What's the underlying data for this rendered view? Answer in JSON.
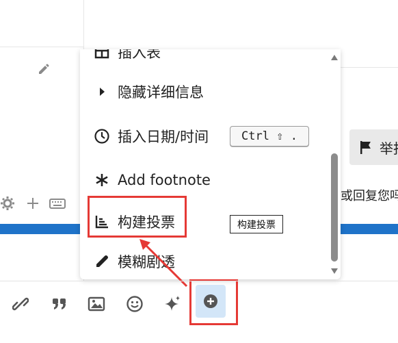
{
  "menu": {
    "items": [
      {
        "label": "插入表",
        "icon": "table-icon"
      },
      {
        "label": "隐藏详细信息",
        "icon": "caret-right-icon"
      },
      {
        "label": "插入日期/时间",
        "icon": "clock-icon",
        "shortcut": "Ctrl ⇧ ."
      },
      {
        "label": "Add footnote",
        "icon": "asterisk-icon"
      },
      {
        "label": "构建投票",
        "icon": "poll-icon"
      },
      {
        "label": "模糊剧透",
        "icon": "pen-icon"
      }
    ]
  },
  "tooltip": {
    "text": "构建投票"
  },
  "background": {
    "report_button_label": "举报",
    "right_text": "或回复您吗"
  },
  "toolbar": {
    "buttons": [
      "link-icon",
      "quote-icon",
      "image-icon",
      "emoji-icon",
      "sparkle-icon",
      "plus-circle-icon"
    ]
  },
  "colors": {
    "highlight": "#e53935",
    "accent_band": "#1f73c9",
    "active_button_bg": "#d3e6f8"
  }
}
